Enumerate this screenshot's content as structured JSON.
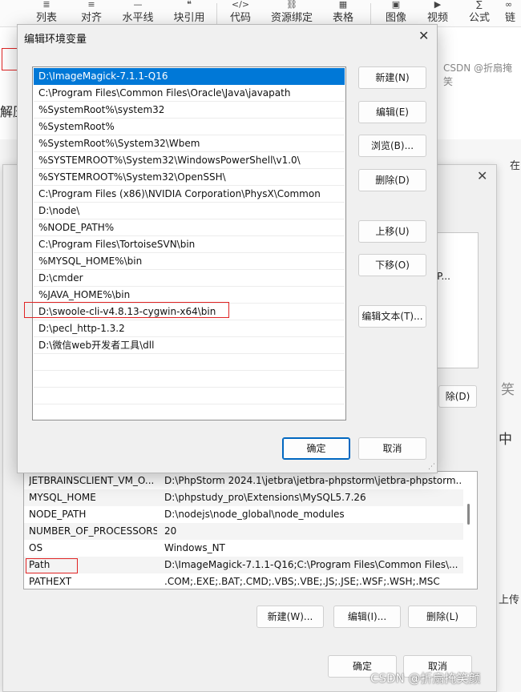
{
  "toolbar": {
    "items": [
      {
        "label": "列表",
        "icon": "list-icon",
        "glyph": "≣"
      },
      {
        "label": "对齐",
        "icon": "align-icon",
        "glyph": "≡"
      },
      {
        "label": "水平线",
        "icon": "hr-icon",
        "glyph": "—"
      },
      {
        "label": "块引用",
        "icon": "quote-icon",
        "glyph": "❝"
      },
      {
        "label": "代码",
        "icon": "code-icon",
        "glyph": "</>"
      },
      {
        "label": "资源绑定",
        "icon": "link-icon",
        "glyph": "⛓"
      },
      {
        "label": "表格",
        "icon": "table-icon",
        "glyph": "▦"
      },
      {
        "label": "图像",
        "icon": "image-icon",
        "glyph": "▣"
      },
      {
        "label": "视频",
        "icon": "video-icon",
        "glyph": "▶"
      },
      {
        "label": "公式",
        "icon": "formula-icon",
        "glyph": "∑"
      },
      {
        "label": "链",
        "icon": "chain-icon",
        "glyph": "∞"
      }
    ]
  },
  "background": {
    "left_text": "解压",
    "right_texts": [
      "笑",
      "中"
    ],
    "tab_label": "在",
    "upload_label": "上传",
    "csdn_top": "CSDN @折扇掩笑",
    "csdn_bottom": "CSDN @折扇掩笑颜",
    "upper_path": ":\\P...",
    "upper_delete": "除(D)",
    "env_list": [
      {
        "name": "JETBRAINSCLIENT_VM_O...",
        "value": "D:\\PhpStorm 2024.1\\jetbra\\jetbra-phpstorm\\jetbra-phpstorm..."
      },
      {
        "name": "MYSQL_HOME",
        "value": "D:\\phpstudy_pro\\Extensions\\MySQL5.7.26"
      },
      {
        "name": "NODE_PATH",
        "value": "D:\\nodejs\\node_global\\node_modules"
      },
      {
        "name": "NUMBER_OF_PROCESSORS",
        "value": "20"
      },
      {
        "name": "OS",
        "value": "Windows_NT"
      },
      {
        "name": "Path",
        "value": "D:\\ImageMagick-7.1.1-Q16;C:\\Program Files\\Common Files\\..."
      },
      {
        "name": "PATHEXT",
        "value": ".COM;.EXE;.BAT;.CMD;.VBS;.VBE;.JS;.JSE;.WSF;.WSH;.MSC"
      }
    ],
    "buttons": {
      "new": "新建(W)...",
      "edit": "编辑(I)...",
      "delete": "删除(L)",
      "ok": "确定",
      "cancel": "取消"
    }
  },
  "dialog": {
    "title": "编辑环境变量",
    "paths": [
      "D:\\ImageMagick-7.1.1-Q16",
      "C:\\Program Files\\Common Files\\Oracle\\Java\\javapath",
      "%SystemRoot%\\system32",
      "%SystemRoot%",
      "%SystemRoot%\\System32\\Wbem",
      "%SYSTEMROOT%\\System32\\WindowsPowerShell\\v1.0\\",
      "%SYSTEMROOT%\\System32\\OpenSSH\\",
      "C:\\Program Files (x86)\\NVIDIA Corporation\\PhysX\\Common",
      "D:\\node\\",
      "%NODE_PATH%",
      "C:\\Program Files\\TortoiseSVN\\bin",
      "%MYSQL_HOME%\\bin",
      "D:\\cmder",
      "%JAVA_HOME%\\bin",
      "D:\\swoole-cli-v4.8.13-cygwin-x64\\bin",
      "D:\\pecl_http-1.3.2",
      "D:\\微信web开发者工具\\dll"
    ],
    "buttons": {
      "new": "新建(N)",
      "edit": "编辑(E)",
      "browse": "浏览(B)...",
      "delete": "删除(D)",
      "up": "上移(U)",
      "down": "下移(O)",
      "edit_text": "编辑文本(T)...",
      "ok": "确定",
      "cancel": "取消"
    }
  }
}
